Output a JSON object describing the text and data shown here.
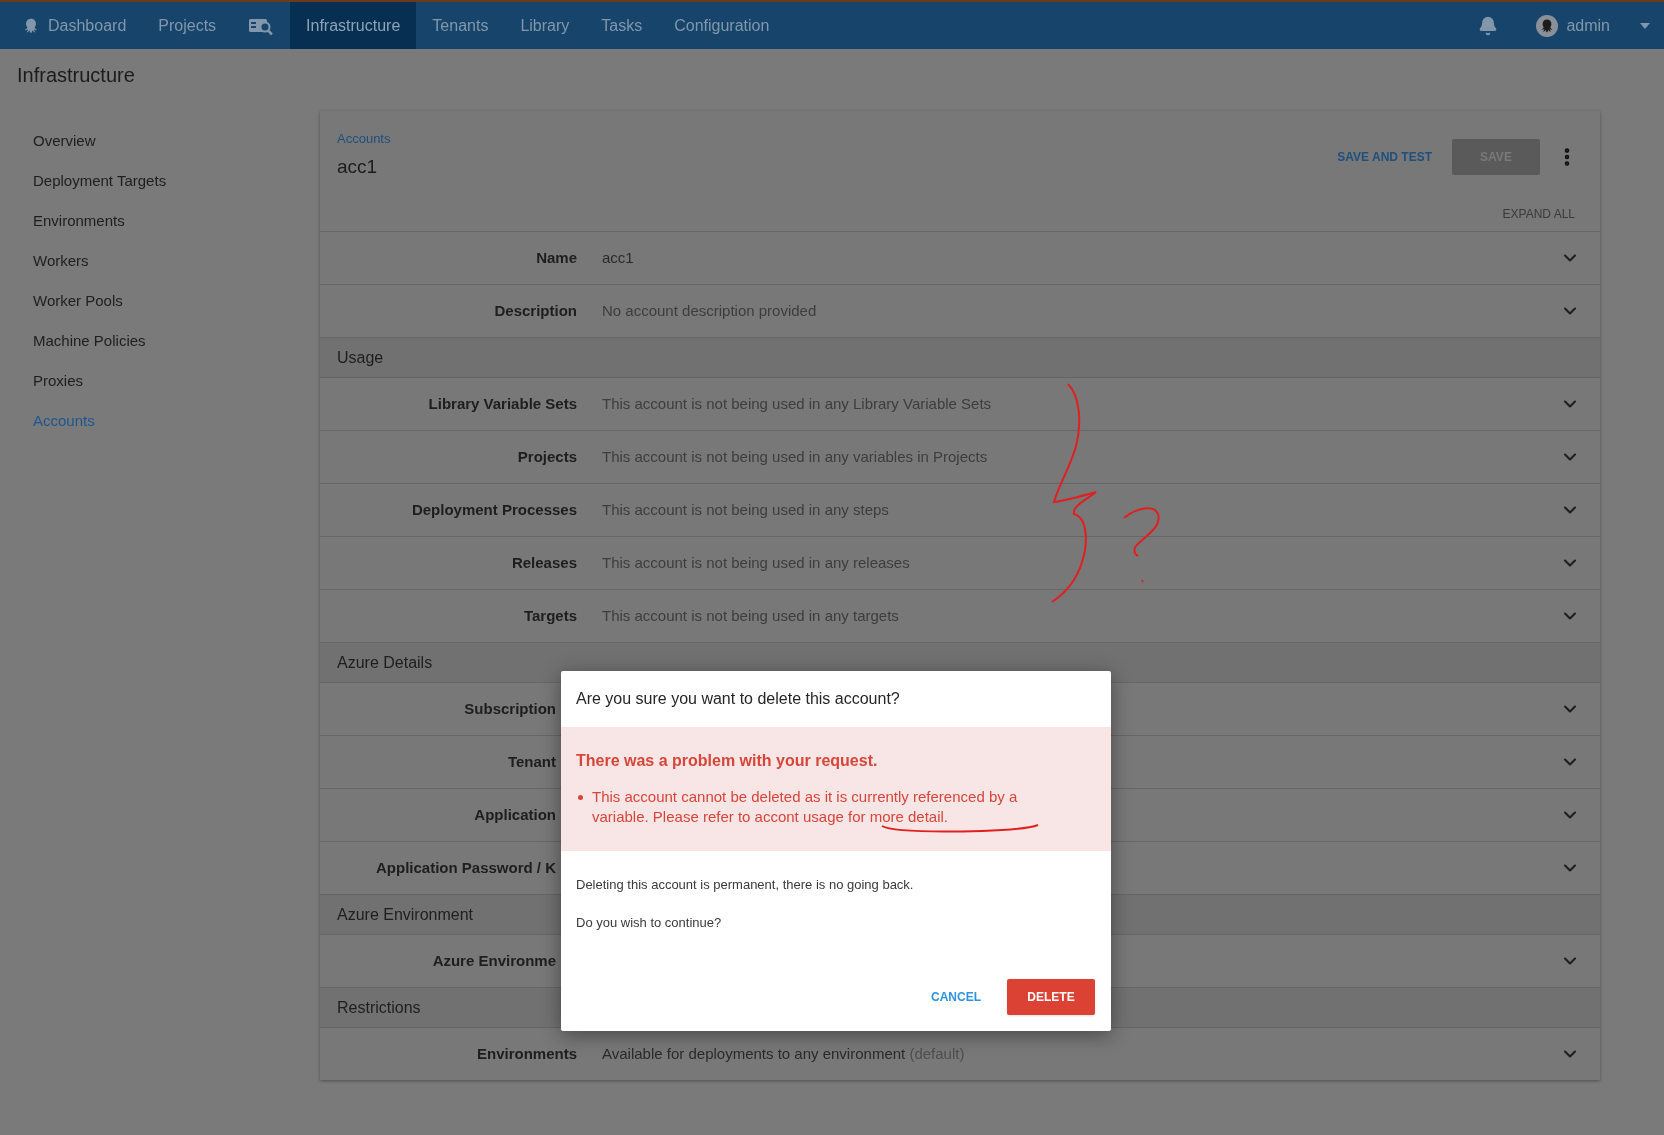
{
  "nav": {
    "items": [
      {
        "kind": "logo",
        "label": "Dashboard",
        "selected": false
      },
      {
        "kind": "text",
        "label": "Projects",
        "selected": false
      },
      {
        "kind": "icon",
        "selected": false
      },
      {
        "kind": "text",
        "label": "Infrastructure",
        "selected": true
      },
      {
        "kind": "text",
        "label": "Tenants",
        "selected": false
      },
      {
        "kind": "text",
        "label": "Library",
        "selected": false
      },
      {
        "kind": "text",
        "label": "Tasks",
        "selected": false
      },
      {
        "kind": "text",
        "label": "Configuration",
        "selected": false
      }
    ],
    "user": "admin"
  },
  "page_title": "Infrastructure",
  "sidebar": {
    "items": [
      {
        "label": "Overview",
        "selected": false
      },
      {
        "label": "Deployment Targets",
        "selected": false
      },
      {
        "label": "Environments",
        "selected": false
      },
      {
        "label": "Workers",
        "selected": false
      },
      {
        "label": "Worker Pools",
        "selected": false
      },
      {
        "label": "Machine Policies",
        "selected": false
      },
      {
        "label": "Proxies",
        "selected": false
      },
      {
        "label": "Accounts",
        "selected": true
      }
    ]
  },
  "card": {
    "breadcrumb": "Accounts",
    "title": "acc1",
    "save_and_test": "SAVE AND TEST",
    "save": {
      "label": "SAVE",
      "disabled": true
    },
    "expand_all": "EXPAND ALL",
    "rows": [
      {
        "kind": "field",
        "label": "Name",
        "value": "acc1"
      },
      {
        "kind": "field",
        "label": "Description",
        "value": "No account description provided"
      },
      {
        "kind": "section",
        "label": "Usage"
      },
      {
        "kind": "field",
        "label": "Library Variable Sets",
        "value": "This account is not being used in any Library Variable Sets"
      },
      {
        "kind": "field",
        "label": "Projects",
        "value": "This account is not being used in any variables in Projects"
      },
      {
        "kind": "field",
        "label": "Deployment Processes",
        "value": "This account is not being used in any steps"
      },
      {
        "kind": "field",
        "label": "Releases",
        "value": "This account is not being used in any releases"
      },
      {
        "kind": "field",
        "label": "Targets",
        "value": "This account is not being used in any targets"
      },
      {
        "kind": "section",
        "label": "Azure Details"
      },
      {
        "kind": "covered",
        "label": "Subscription"
      },
      {
        "kind": "covered",
        "label": "Tenant"
      },
      {
        "kind": "covered",
        "label": "Application"
      },
      {
        "kind": "covered",
        "label": "Application Password / K"
      },
      {
        "kind": "section",
        "label": "Azure Environment"
      },
      {
        "kind": "covered",
        "label": "Azure Environme"
      },
      {
        "kind": "section",
        "label": "Restrictions"
      },
      {
        "kind": "field",
        "label": "Environments",
        "value": "Available for deployments to any environment",
        "note": "(default)"
      }
    ]
  },
  "dialog": {
    "title": "Are you sure you want to delete this account?",
    "error": {
      "heading": "There was a problem with your request.",
      "items": [
        "This account cannot be deleted as it is currently referenced by a variable. Please refer to accont usage for more detail."
      ]
    },
    "paragraphs": [
      "Deleting this account is permanent, there is no going back.",
      "Do you wish to continue?"
    ],
    "cancel": "CANCEL",
    "delete": "DELETE"
  }
}
